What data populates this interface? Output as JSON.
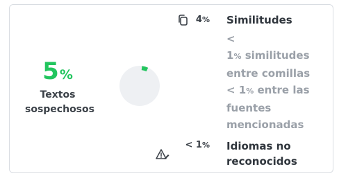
{
  "score": {
    "value": "5",
    "unit": "%",
    "label": "Textos sospechosos",
    "chart_fraction": 0.05,
    "color": "#22c55e"
  },
  "stats": {
    "similitudes": {
      "icon": "copy-icon",
      "pct_value": "4",
      "pct_unit": "%",
      "label": "Similitudes"
    },
    "comillas": {
      "lt": "<",
      "pct_value": "1",
      "pct_unit": "%",
      "label": "similitudes entre comillas"
    },
    "fuentes": {
      "pct_value": "< 1",
      "pct_unit": "%",
      "label": "entre las fuentes mencionadas"
    },
    "idiomas": {
      "icon": "warning-edit-icon",
      "pct_value": "< 1",
      "pct_unit": "%",
      "label": "Idiomas no reconocidos"
    }
  }
}
